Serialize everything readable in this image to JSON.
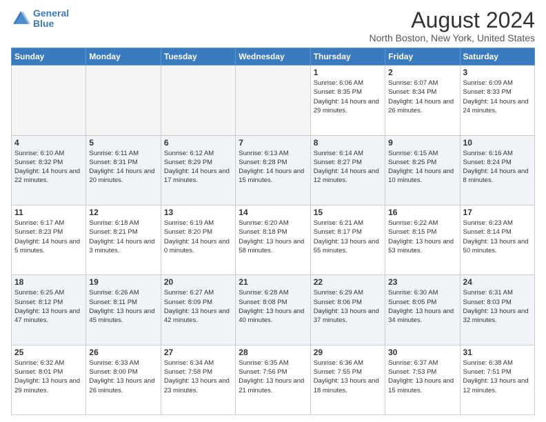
{
  "logo": {
    "line1": "General",
    "line2": "Blue"
  },
  "title": "August 2024",
  "subtitle": "North Boston, New York, United States",
  "weekdays": [
    "Sunday",
    "Monday",
    "Tuesday",
    "Wednesday",
    "Thursday",
    "Friday",
    "Saturday"
  ],
  "weeks": [
    [
      {
        "day": "",
        "info": ""
      },
      {
        "day": "",
        "info": ""
      },
      {
        "day": "",
        "info": ""
      },
      {
        "day": "",
        "info": ""
      },
      {
        "day": "1",
        "info": "Sunrise: 6:06 AM\nSunset: 8:35 PM\nDaylight: 14 hours and 29 minutes."
      },
      {
        "day": "2",
        "info": "Sunrise: 6:07 AM\nSunset: 8:34 PM\nDaylight: 14 hours and 26 minutes."
      },
      {
        "day": "3",
        "info": "Sunrise: 6:09 AM\nSunset: 8:33 PM\nDaylight: 14 hours and 24 minutes."
      }
    ],
    [
      {
        "day": "4",
        "info": "Sunrise: 6:10 AM\nSunset: 8:32 PM\nDaylight: 14 hours and 22 minutes."
      },
      {
        "day": "5",
        "info": "Sunrise: 6:11 AM\nSunset: 8:31 PM\nDaylight: 14 hours and 20 minutes."
      },
      {
        "day": "6",
        "info": "Sunrise: 6:12 AM\nSunset: 8:29 PM\nDaylight: 14 hours and 17 minutes."
      },
      {
        "day": "7",
        "info": "Sunrise: 6:13 AM\nSunset: 8:28 PM\nDaylight: 14 hours and 15 minutes."
      },
      {
        "day": "8",
        "info": "Sunrise: 6:14 AM\nSunset: 8:27 PM\nDaylight: 14 hours and 12 minutes."
      },
      {
        "day": "9",
        "info": "Sunrise: 6:15 AM\nSunset: 8:25 PM\nDaylight: 14 hours and 10 minutes."
      },
      {
        "day": "10",
        "info": "Sunrise: 6:16 AM\nSunset: 8:24 PM\nDaylight: 14 hours and 8 minutes."
      }
    ],
    [
      {
        "day": "11",
        "info": "Sunrise: 6:17 AM\nSunset: 8:23 PM\nDaylight: 14 hours and 5 minutes."
      },
      {
        "day": "12",
        "info": "Sunrise: 6:18 AM\nSunset: 8:21 PM\nDaylight: 14 hours and 3 minutes."
      },
      {
        "day": "13",
        "info": "Sunrise: 6:19 AM\nSunset: 8:20 PM\nDaylight: 14 hours and 0 minutes."
      },
      {
        "day": "14",
        "info": "Sunrise: 6:20 AM\nSunset: 8:18 PM\nDaylight: 13 hours and 58 minutes."
      },
      {
        "day": "15",
        "info": "Sunrise: 6:21 AM\nSunset: 8:17 PM\nDaylight: 13 hours and 55 minutes."
      },
      {
        "day": "16",
        "info": "Sunrise: 6:22 AM\nSunset: 8:15 PM\nDaylight: 13 hours and 53 minutes."
      },
      {
        "day": "17",
        "info": "Sunrise: 6:23 AM\nSunset: 8:14 PM\nDaylight: 13 hours and 50 minutes."
      }
    ],
    [
      {
        "day": "18",
        "info": "Sunrise: 6:25 AM\nSunset: 8:12 PM\nDaylight: 13 hours and 47 minutes."
      },
      {
        "day": "19",
        "info": "Sunrise: 6:26 AM\nSunset: 8:11 PM\nDaylight: 13 hours and 45 minutes."
      },
      {
        "day": "20",
        "info": "Sunrise: 6:27 AM\nSunset: 8:09 PM\nDaylight: 13 hours and 42 minutes."
      },
      {
        "day": "21",
        "info": "Sunrise: 6:28 AM\nSunset: 8:08 PM\nDaylight: 13 hours and 40 minutes."
      },
      {
        "day": "22",
        "info": "Sunrise: 6:29 AM\nSunset: 8:06 PM\nDaylight: 13 hours and 37 minutes."
      },
      {
        "day": "23",
        "info": "Sunrise: 6:30 AM\nSunset: 8:05 PM\nDaylight: 13 hours and 34 minutes."
      },
      {
        "day": "24",
        "info": "Sunrise: 6:31 AM\nSunset: 8:03 PM\nDaylight: 13 hours and 32 minutes."
      }
    ],
    [
      {
        "day": "25",
        "info": "Sunrise: 6:32 AM\nSunset: 8:01 PM\nDaylight: 13 hours and 29 minutes."
      },
      {
        "day": "26",
        "info": "Sunrise: 6:33 AM\nSunset: 8:00 PM\nDaylight: 13 hours and 26 minutes."
      },
      {
        "day": "27",
        "info": "Sunrise: 6:34 AM\nSunset: 7:58 PM\nDaylight: 13 hours and 23 minutes."
      },
      {
        "day": "28",
        "info": "Sunrise: 6:35 AM\nSunset: 7:56 PM\nDaylight: 13 hours and 21 minutes."
      },
      {
        "day": "29",
        "info": "Sunrise: 6:36 AM\nSunset: 7:55 PM\nDaylight: 13 hours and 18 minutes."
      },
      {
        "day": "30",
        "info": "Sunrise: 6:37 AM\nSunset: 7:53 PM\nDaylight: 13 hours and 15 minutes."
      },
      {
        "day": "31",
        "info": "Sunrise: 6:38 AM\nSunset: 7:51 PM\nDaylight: 13 hours and 12 minutes."
      }
    ]
  ]
}
